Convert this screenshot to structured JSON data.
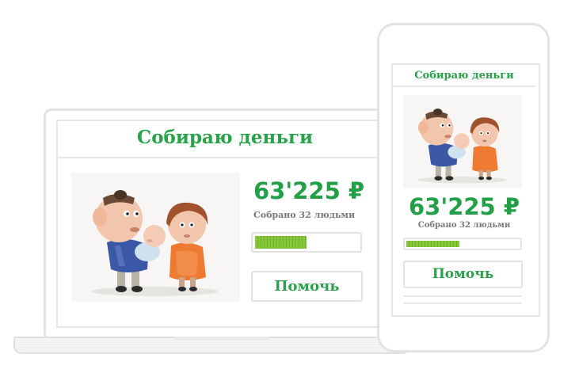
{
  "laptop": {
    "title": "Собираю деньги",
    "amount": "63'225 ₽",
    "collected": "Собрано 32 людьми",
    "progress": 0.5,
    "button_label": "Помочь"
  },
  "phone": {
    "title": "Собираю деньги",
    "amount": "63'225 ₽",
    "collected": "Собрано 32 людьми",
    "progress": 0.47,
    "button_label": "Помочь"
  },
  "colors": {
    "accent": "#2aa24a",
    "progress": "#86c63a",
    "border": "#e3e3e3"
  },
  "icons": {
    "illustration": "family-illustration"
  }
}
